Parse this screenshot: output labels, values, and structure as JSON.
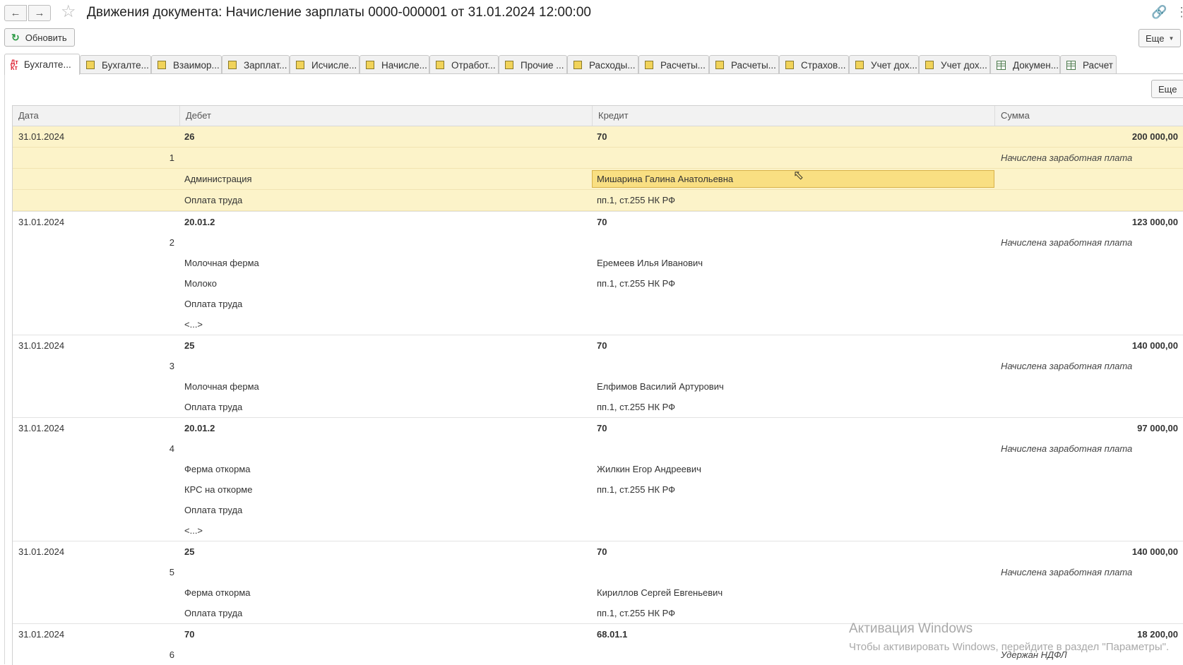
{
  "window": {
    "title": "Движения документа: Начисление зарплаты 0000-000001 от 31.01.2024 12:00:00"
  },
  "toolbar": {
    "refresh_label": "Обновить",
    "more_label": "Еще"
  },
  "tabs": [
    {
      "label": "Бухгалте...",
      "icon": "dt-kt-icon",
      "active": true
    },
    {
      "label": "Бухгалте...",
      "icon": "register-icon"
    },
    {
      "label": "Взаимор...",
      "icon": "register-icon"
    },
    {
      "label": "Зарплат...",
      "icon": "register-icon"
    },
    {
      "label": "Исчисле...",
      "icon": "register-icon"
    },
    {
      "label": "Начисле...",
      "icon": "register-icon"
    },
    {
      "label": "Отработ...",
      "icon": "register-icon"
    },
    {
      "label": "Прочие ...",
      "icon": "register-icon"
    },
    {
      "label": "Расходы...",
      "icon": "register-icon"
    },
    {
      "label": "Расчеты...",
      "icon": "register-icon"
    },
    {
      "label": "Расчеты...",
      "icon": "register-icon"
    },
    {
      "label": "Страхов...",
      "icon": "register-icon"
    },
    {
      "label": "Учет дох...",
      "icon": "register-icon"
    },
    {
      "label": "Учет дох...",
      "icon": "register-icon"
    },
    {
      "label": "Докумен...",
      "icon": "table-icon"
    },
    {
      "label": "Расчет",
      "icon": "table-icon"
    }
  ],
  "table": {
    "more_label": "Еще",
    "columns": {
      "date": "Дата",
      "debit": "Дебет",
      "credit": "Кредит",
      "sum": "Сумма"
    },
    "records": [
      {
        "date": "31.01.2024",
        "num": "1",
        "debit_account": "26",
        "credit_account": "70",
        "sum": "200 000,00",
        "desc": "Начислена заработная плата",
        "debit_sub": [
          "",
          "Администрация",
          "Оплата труда"
        ],
        "credit_sub": [
          "",
          "Мишарина Галина Анатольевна",
          "пп.1, ст.255 НК РФ"
        ]
      },
      {
        "date": "31.01.2024",
        "num": "2",
        "debit_account": "20.01.2",
        "credit_account": "70",
        "sum": "123 000,00",
        "desc": "Начислена заработная плата",
        "debit_sub": [
          "",
          "Молочная ферма",
          "Молоко",
          "Оплата труда",
          "<...>"
        ],
        "credit_sub": [
          "",
          "Еремеев Илья Иванович",
          "пп.1, ст.255 НК РФ",
          "",
          ""
        ]
      },
      {
        "date": "31.01.2024",
        "num": "3",
        "debit_account": "25",
        "credit_account": "70",
        "sum": "140 000,00",
        "desc": "Начислена заработная плата",
        "debit_sub": [
          "",
          "Молочная ферма",
          "Оплата труда"
        ],
        "credit_sub": [
          "",
          "Елфимов Василий Артурович",
          "пп.1, ст.255 НК РФ"
        ]
      },
      {
        "date": "31.01.2024",
        "num": "4",
        "debit_account": "20.01.2",
        "credit_account": "70",
        "sum": "97 000,00",
        "desc": "Начислена заработная плата",
        "debit_sub": [
          "",
          "Ферма откорма",
          "КРС на откорме",
          "Оплата труда",
          "<...>"
        ],
        "credit_sub": [
          "",
          "Жилкин Егор Андреевич",
          "пп.1, ст.255 НК РФ",
          "",
          ""
        ]
      },
      {
        "date": "31.01.2024",
        "num": "5",
        "debit_account": "25",
        "credit_account": "70",
        "sum": "140 000,00",
        "desc": "Начислена заработная плата",
        "debit_sub": [
          "",
          "Ферма откорма",
          "Оплата труда"
        ],
        "credit_sub": [
          "",
          "Кириллов Сергей Евгеньевич",
          "пп.1, ст.255 НК РФ"
        ]
      },
      {
        "date": "31.01.2024",
        "num": "6",
        "debit_account": "70",
        "credit_account": "68.01.1",
        "sum": "18 200,00",
        "desc": "Удержан НДФЛ",
        "debit_sub": [
          ""
        ],
        "credit_sub": [
          ""
        ]
      }
    ]
  },
  "watermark": {
    "line1": "Активация Windows",
    "line2": "Чтобы активировать Windows, перейдите в раздел \"Параметры\"."
  }
}
